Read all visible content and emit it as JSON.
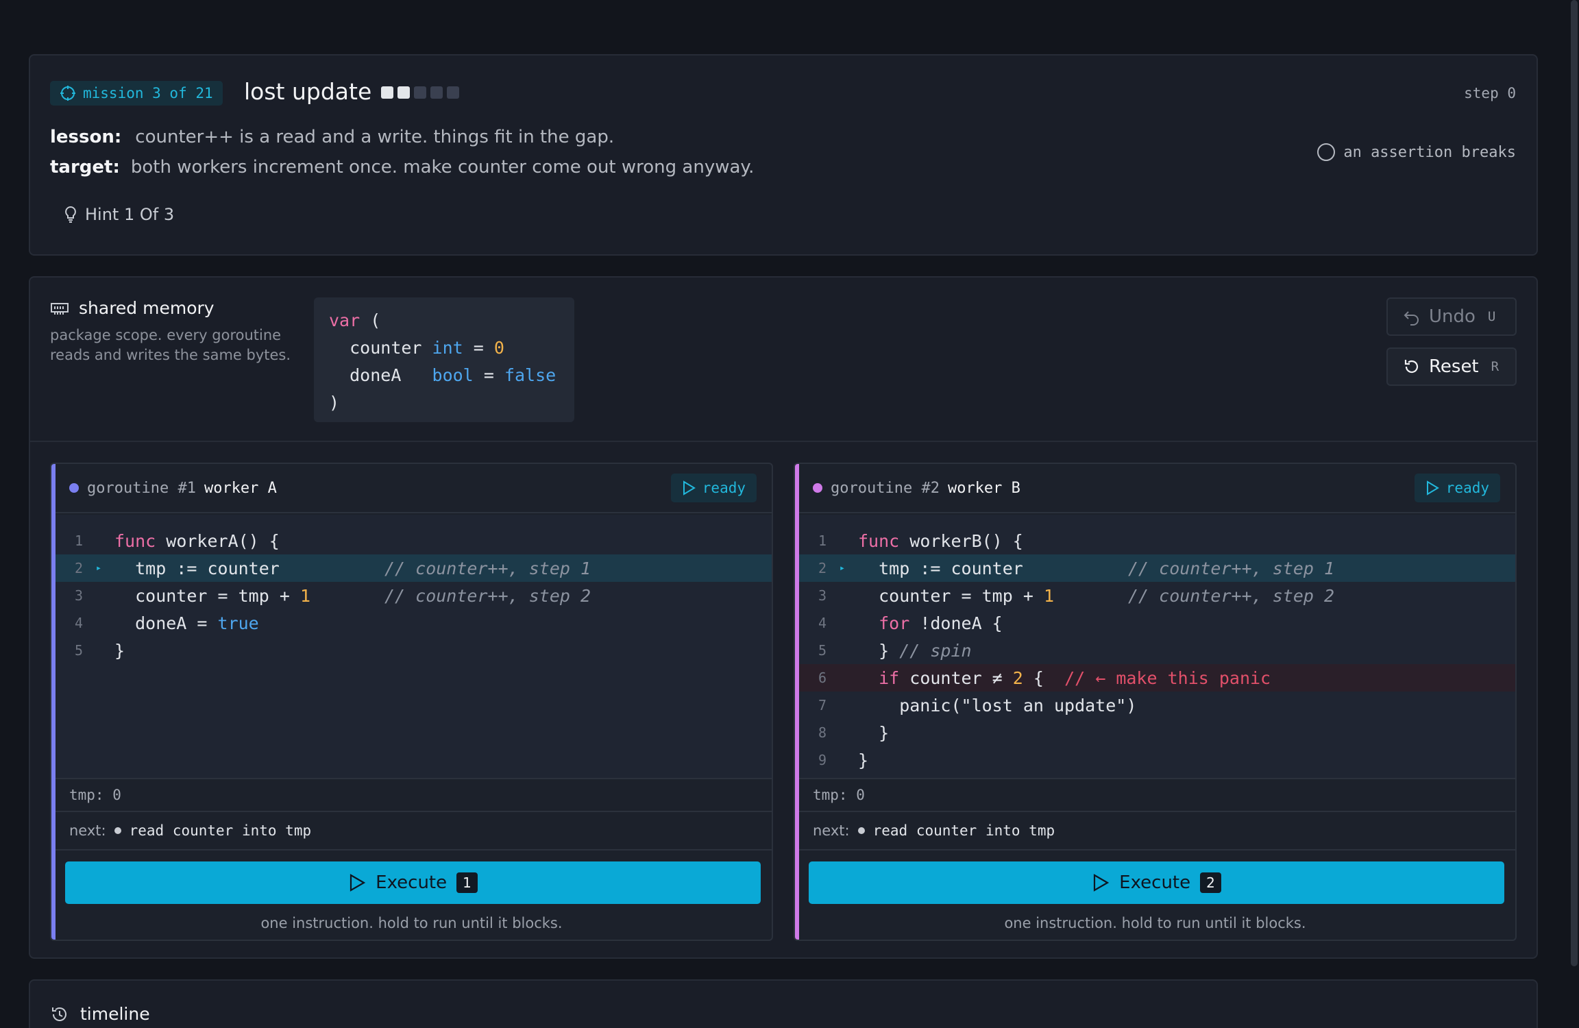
{
  "mission": {
    "badge": "mission 3 of 21",
    "title": "lost update",
    "difficulty": {
      "filled": 2,
      "total": 5
    },
    "step": "step 0",
    "lesson_key": "lesson:",
    "lesson": "counter++ is a read and a write. things fit in the gap.",
    "target_key": "target:",
    "target": "both workers increment once. make counter come out wrong anyway.",
    "goal": "an assertion breaks",
    "hint": "Hint 1 Of 3"
  },
  "memory": {
    "title": "shared memory",
    "description": "package scope. every goroutine reads and writes the same bytes.",
    "code": {
      "var_kw": "var",
      "open": "(",
      "v1_name": "counter",
      "v1_type": "int",
      "v1_eq": "=",
      "v1_val": "0",
      "v2_name": "doneA",
      "v2_type": "bool",
      "v2_eq": "=",
      "v2_val": "false",
      "close": ")"
    }
  },
  "controls": {
    "undo_label": "Undo",
    "undo_key": "U",
    "reset_label": "Reset",
    "reset_key": "R"
  },
  "goroutines": [
    {
      "id": "goroutine #1",
      "name": "worker A",
      "status": "ready",
      "tmp": "tmp: 0",
      "next_label": "next:",
      "next": "read counter into tmp",
      "execute_label": "Execute",
      "execute_key": "1",
      "note": "one instruction. hold to run until it blocks."
    },
    {
      "id": "goroutine #2",
      "name": "worker B",
      "status": "ready",
      "tmp": "tmp: 0",
      "next_label": "next:",
      "next": "read counter into tmp",
      "execute_label": "Execute",
      "execute_key": "2",
      "note": "one instruction. hold to run until it blocks."
    }
  ],
  "code_a": {
    "n": [
      "1",
      "2",
      "3",
      "4",
      "5"
    ],
    "func_kw": "func",
    "sig": " workerA() {",
    "l2": "  tmp := counter",
    "l2c": "// counter++, step 1",
    "l3a": "  counter = tmp + ",
    "l3n": "1",
    "l3c": "// counter++, step 2",
    "l4a": "  doneA = ",
    "l4b": "true",
    "l5": "}"
  },
  "code_b": {
    "n": [
      "1",
      "2",
      "3",
      "4",
      "5",
      "6",
      "7",
      "8",
      "9"
    ],
    "func_kw": "func",
    "sig": " workerB() {",
    "l2": "  tmp := counter",
    "l2c": "// counter++, step 1",
    "l3a": "  counter = tmp + ",
    "l3n": "1",
    "l3c": "// counter++, step 2",
    "l4kw": "for",
    "l4": " !doneA {",
    "l5a": "  } ",
    "l5c": "// spin",
    "l6kw": "if",
    "l6a": " counter ≠ ",
    "l6n": "2",
    "l6b": " {",
    "l6c": "// ← make this panic",
    "l7": "    panic(\"lost an update\")",
    "l8": "  }",
    "l9": "}"
  },
  "timeline": {
    "title": "timeline"
  },
  "colors": {
    "accent": "#0aa9d6",
    "worker_a": "#7a7ff0",
    "worker_b": "#cf7ae8",
    "danger": "#e2506a"
  },
  "icons": [
    "target-icon",
    "lightbulb-icon",
    "memory-icon",
    "undo-icon",
    "reset-icon",
    "play-icon",
    "history-icon"
  ]
}
